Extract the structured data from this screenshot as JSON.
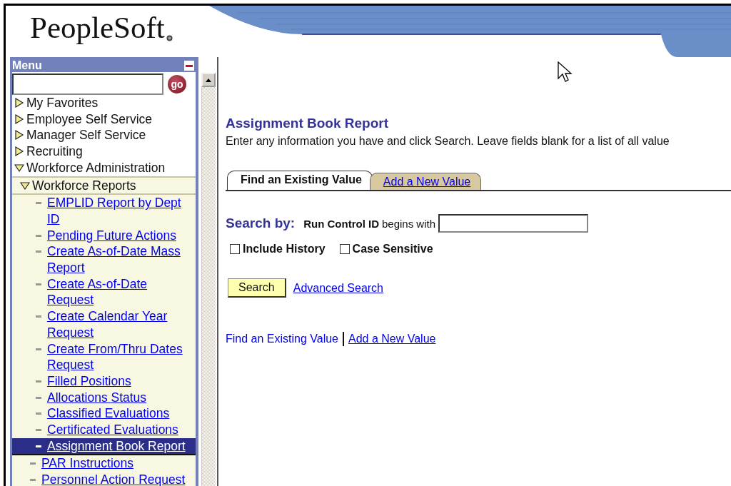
{
  "header": {
    "logo": "PeopleSoft"
  },
  "menu": {
    "title": "Menu",
    "go_label": "go",
    "items": [
      {
        "label": "My Favorites",
        "kind": "folder",
        "expanded": false
      },
      {
        "label": "Employee Self Service",
        "kind": "folder",
        "expanded": false
      },
      {
        "label": "Manager Self Service",
        "kind": "folder",
        "expanded": false
      },
      {
        "label": "Recruiting",
        "kind": "folder",
        "expanded": false
      },
      {
        "label": "Workforce Administration",
        "kind": "folder",
        "expanded": true,
        "children": [
          {
            "label": "Workforce Reports",
            "kind": "folder",
            "expanded": true,
            "children": [
              {
                "label": "EMPLID Report by Dept ID",
                "kind": "link",
                "selected": false
              },
              {
                "label": "Pending Future Actions",
                "kind": "link",
                "selected": false
              },
              {
                "label": "Create As-of-Date Mass Report",
                "kind": "link",
                "selected": false
              },
              {
                "label": "Create As-of-Date Request",
                "kind": "link",
                "selected": false
              },
              {
                "label": "Create Calendar Year Request",
                "kind": "link",
                "selected": false
              },
              {
                "label": "Create From/Thru Dates Request",
                "kind": "link",
                "selected": false
              },
              {
                "label": "Filled Positions",
                "kind": "link",
                "selected": false
              },
              {
                "label": "Allocations Status",
                "kind": "link",
                "selected": false
              },
              {
                "label": "Classified Evaluations",
                "kind": "link",
                "selected": false
              },
              {
                "label": "Certificated Evaluations",
                "kind": "link",
                "selected": false
              },
              {
                "label": "Assignment Book Report",
                "kind": "link",
                "selected": true
              }
            ]
          },
          {
            "label": "PAR Instructions",
            "kind": "link",
            "selected": false
          },
          {
            "label": "Personnel Action Request",
            "kind": "link",
            "selected": false
          }
        ]
      }
    ]
  },
  "content": {
    "title": "Assignment Book Report",
    "instructions": "Enter any information you have and click Search. Leave fields blank for a list of all value",
    "tabs": [
      {
        "label": "Find an Existing Value",
        "selected": true
      },
      {
        "label": "Add a New Value",
        "selected": false
      }
    ],
    "search_by": "Search by:",
    "field_label": "Run Control ID",
    "operator": "begins with",
    "checkboxes": [
      {
        "label": "Include History",
        "checked": false
      },
      {
        "label": "Case Sensitive",
        "checked": false
      }
    ],
    "search_button": "Search",
    "advanced_link": "Advanced Search",
    "bottom_links": [
      "Find an Existing Value",
      "Add a New Value"
    ]
  }
}
